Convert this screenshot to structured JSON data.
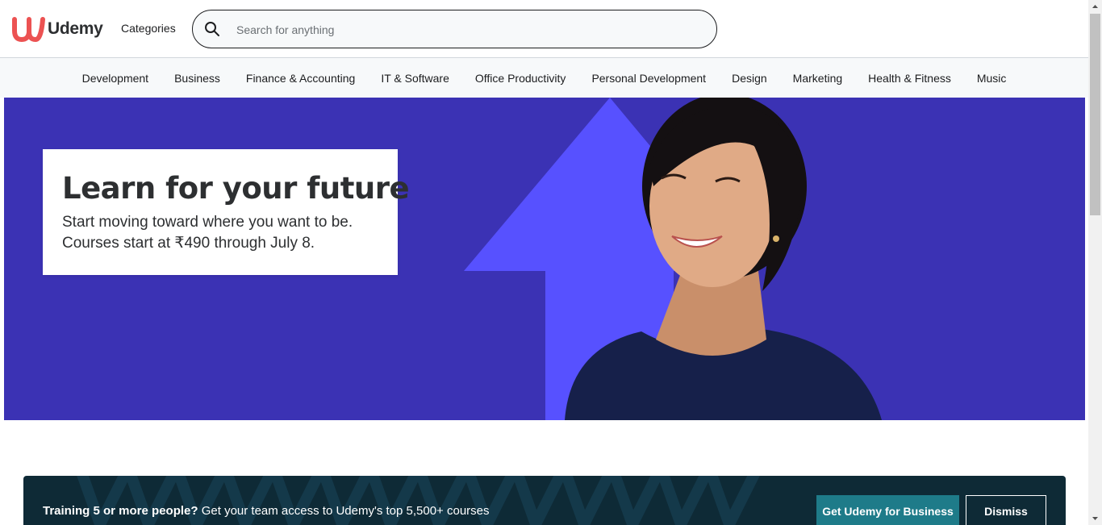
{
  "header": {
    "logo_text": "Udemy",
    "categories_label": "Categories",
    "search": {
      "placeholder": "Search for anything",
      "icon": "search-icon"
    }
  },
  "nav": {
    "items": [
      {
        "label": "Development"
      },
      {
        "label": "Business"
      },
      {
        "label": "Finance & Accounting"
      },
      {
        "label": "IT & Software"
      },
      {
        "label": "Office Productivity"
      },
      {
        "label": "Personal Development"
      },
      {
        "label": "Design"
      },
      {
        "label": "Marketing"
      },
      {
        "label": "Health & Fitness"
      },
      {
        "label": "Music"
      }
    ]
  },
  "hero": {
    "title": "Learn for your future",
    "subtitle_line1": "Start moving toward where you want to be.",
    "subtitle_line2": "Courses start at ₹490 through July 8.",
    "background_color": "#3b32b4",
    "arrow_color": "#5751ff"
  },
  "banner": {
    "bold_text": "Training 5 or more people?",
    "text": "Get your team access to Udemy's top 5,500+ courses",
    "primary_button": "Get Udemy for Business",
    "secondary_button": "Dismiss",
    "primary_color": "#1e7b89"
  },
  "colors": {
    "brand": "#a435f0",
    "logo_red": "#ec5252"
  }
}
